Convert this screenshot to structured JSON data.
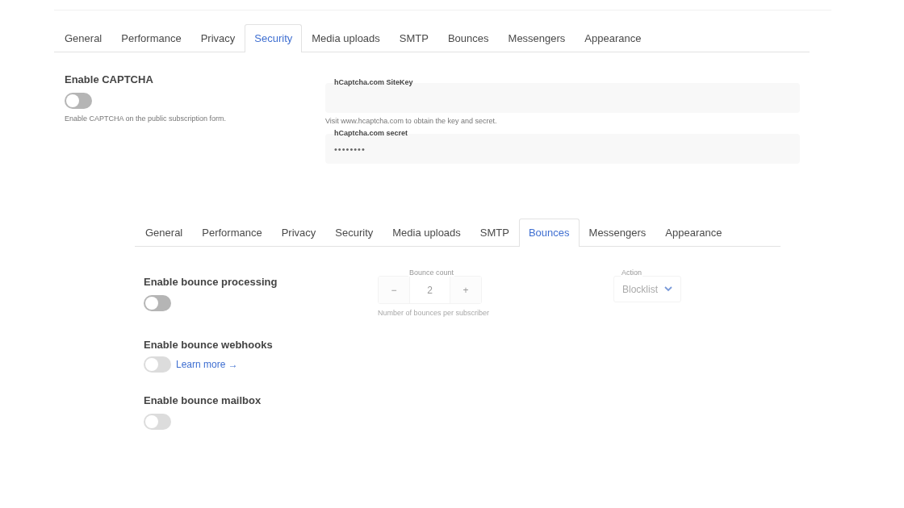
{
  "security_panel": {
    "tabs": [
      {
        "label": "General",
        "selected": false
      },
      {
        "label": "Performance",
        "selected": false
      },
      {
        "label": "Privacy",
        "selected": false
      },
      {
        "label": "Security",
        "selected": true
      },
      {
        "label": "Media uploads",
        "selected": false
      },
      {
        "label": "SMTP",
        "selected": false
      },
      {
        "label": "Bounces",
        "selected": false
      },
      {
        "label": "Messengers",
        "selected": false
      },
      {
        "label": "Appearance",
        "selected": false
      }
    ],
    "captcha": {
      "label": "Enable CAPTCHA",
      "on": false,
      "disabled": false,
      "help": "Enable CAPTCHA on the public subscription form."
    },
    "fields": [
      {
        "label": "hCaptcha.com SiteKey",
        "help": "Visit www.hcaptcha.com to obtain the key and secret."
      },
      {
        "label": "hCaptcha.com secret",
        "value": "••••••••"
      }
    ]
  },
  "bounces_panel": {
    "tabs": [
      {
        "label": "General",
        "selected": false
      },
      {
        "label": "Performance",
        "selected": false
      },
      {
        "label": "Privacy",
        "selected": false
      },
      {
        "label": "Security",
        "selected": false
      },
      {
        "label": "Media uploads",
        "selected": false
      },
      {
        "label": "SMTP",
        "selected": false
      },
      {
        "label": "Bounces",
        "selected": true
      },
      {
        "label": "Messengers",
        "selected": false
      },
      {
        "label": "Appearance",
        "selected": false
      }
    ],
    "processing": {
      "label": "Enable bounce processing",
      "on": false,
      "disabled": false,
      "bounce_count": {
        "label": "Bounce count",
        "minus": "−",
        "value": "2",
        "plus": "+",
        "help": "Number of bounces per subscriber",
        "disabled": true
      },
      "action": {
        "label": "Action",
        "value": "Blocklist",
        "disabled": true
      }
    },
    "webhooks": {
      "label": "Enable bounce webhooks",
      "on": false,
      "disabled": true,
      "link": "Learn more →"
    },
    "mailbox": {
      "label": "Enable bounce mailbox",
      "on": false,
      "disabled": true
    }
  }
}
